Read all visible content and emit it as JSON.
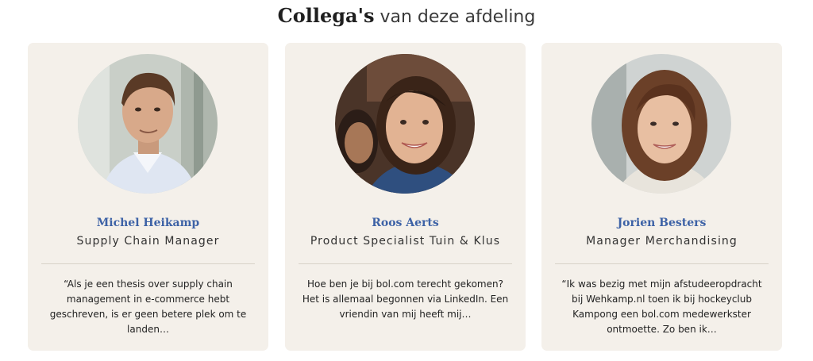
{
  "heading": {
    "bold": "Collega's",
    "light": " van deze afdeling"
  },
  "colleagues": [
    {
      "name": "Michel Heikamp",
      "role": "Supply Chain Manager",
      "quote": "“Als je een thesis over supply chain management in e-commerce hebt geschreven, is er geen betere plek om te landen…"
    },
    {
      "name": "Roos Aerts",
      "role": "Product Specialist Tuin & Klus",
      "quote": "Hoe ben je bij bol.com terecht gekomen? Het is allemaal begonnen via LinkedIn. Een vriendin van mij heeft mij…"
    },
    {
      "name": "Jorien Besters",
      "role": "Manager Merchandising",
      "quote": "“Ik was bezig met mijn afstudeeropdracht bij Wehkamp.nl toen ik bij hockeyclub Kampong een bol.com medewerkster ontmoette. Zo ben ik…"
    }
  ],
  "colors": {
    "card_background": "#f4f0ea",
    "name": "#3d62a6",
    "divider": "#d8d2c8"
  }
}
